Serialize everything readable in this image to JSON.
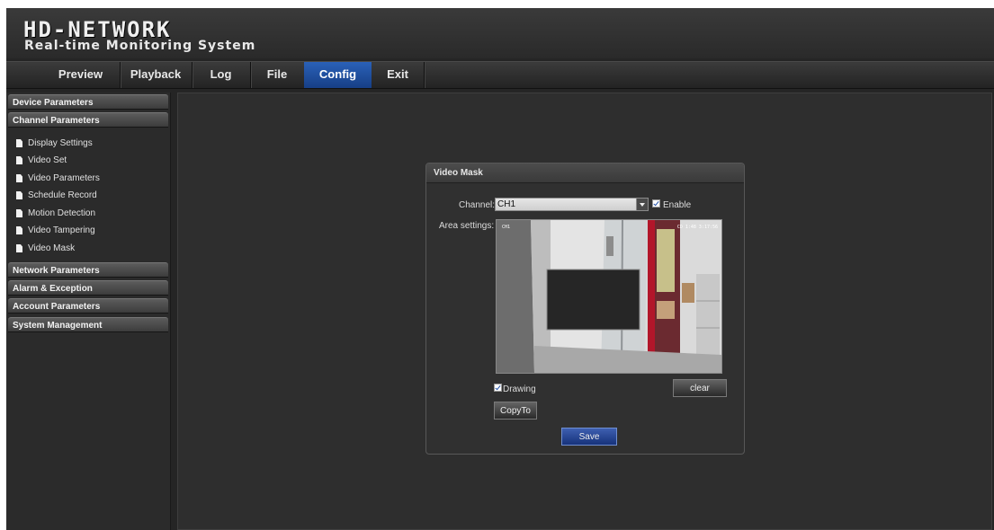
{
  "header": {
    "brand": "HD-NETWORK",
    "subtitle": "Real-time Monitoring System"
  },
  "nav": {
    "items": [
      {
        "label": "Preview",
        "active": false
      },
      {
        "label": "Playback",
        "active": false
      },
      {
        "label": "Log",
        "active": false
      },
      {
        "label": "File",
        "active": false
      },
      {
        "label": "Config",
        "active": true
      },
      {
        "label": "Exit",
        "active": false
      }
    ],
    "active_color": "#2456b0"
  },
  "sidebar": {
    "categories": [
      "Device Parameters",
      "Channel Parameters",
      "Network Parameters",
      "Alarm & Exception",
      "Account Parameters",
      "System Management"
    ],
    "channel_items": [
      "Display Settings",
      "Video Set",
      "Video Parameters",
      "Schedule Record",
      "Motion Detection",
      "Video Tampering",
      "Video Mask"
    ],
    "item_icon": "document-icon"
  },
  "panel": {
    "title": "Video Mask",
    "channel_label": "Channel:",
    "channel_value": "CH1",
    "enable_label": "Enable",
    "enable_checked": true,
    "area_label": "Area settings:",
    "video_overlay_left": "CH1",
    "video_overlay_right": "CD 1:48 3:17:56",
    "drawing_label": "Drawing",
    "drawing_checked": true,
    "clear_label": "clear",
    "copyto_label": "CopyTo",
    "save_label": "Save",
    "save_color": "#1e3f8f"
  }
}
